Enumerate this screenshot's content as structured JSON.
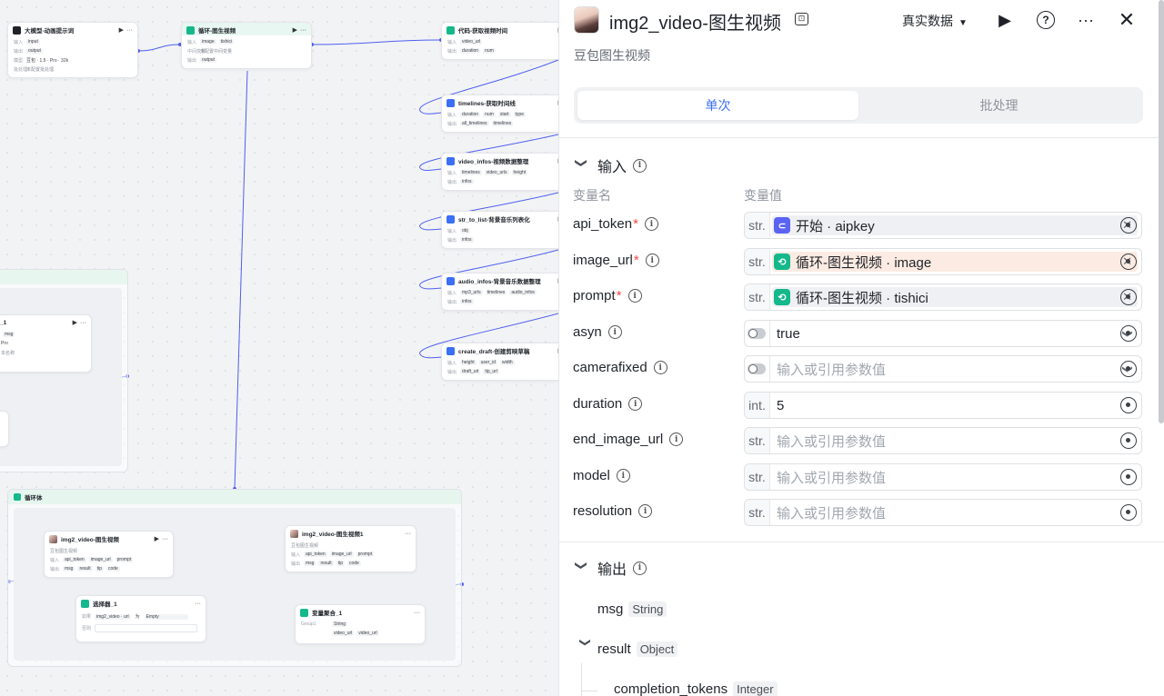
{
  "canvas": {
    "nodes": {
      "llm": {
        "title": "大模型-动画提示词",
        "r1k": "输入",
        "r1": "input",
        "r2k": "输出",
        "r2": "output",
        "r3k": "模型",
        "r3": "豆包 · 1.5 · Pro · 32k",
        "r4k": "批处理",
        "r4": "未配置批处理"
      },
      "loop": {
        "title": "循环-图生视频",
        "r1k": "输入",
        "r1a": "image",
        "r1b": "tishici",
        "r2k": "中间变量",
        "r2": "未配置中间变量",
        "r3k": "输出",
        "r3": "output"
      },
      "code": {
        "title": "代码-获取视频时间",
        "r1k": "输入",
        "r1": "video_url",
        "r2k": "输出",
        "r2a": "duration",
        "r2b": "num"
      },
      "timelines": {
        "title": "timelines-获取时间线",
        "r1k": "输入",
        "r1a": "duration",
        "r1b": "num",
        "r1c": "start",
        "r1d": "type",
        "r2k": "输出",
        "r2a": "all_timelines",
        "r2b": "timelines"
      },
      "video_infos": {
        "title": "video_infos-视频数据整理",
        "r1k": "输入",
        "r1a": "timelines",
        "r1b": "video_urls",
        "r1c": "height",
        "r2k": "输出",
        "r2": "infos"
      },
      "str_to_list": {
        "title": "str_to_list-背景音乐列表化",
        "r1k": "输入",
        "r1": "obj",
        "r2k": "输出",
        "r2": "infos"
      },
      "audio_infos": {
        "title": "audio_infos-背景音乐数据整理",
        "r1k": "输入",
        "r1a": "mp3_urls",
        "r1b": "timelines",
        "r1c": "audio_infos",
        "r2k": "输出",
        "r2": "infos"
      },
      "create_draft": {
        "title": "create_draft-创建剪映草稿",
        "r1k": "输入",
        "r1a": "height",
        "r1b": "user_id",
        "r1c": "width",
        "r2k": "输出",
        "r2a": "draft_url",
        "r2b": "tip_url"
      },
      "partial": {
        "title": "_1",
        "r1": "msg",
        "r2": "Pro",
        "r3": "本名称"
      },
      "loopbody": {
        "title": "循环体"
      },
      "img2video": {
        "title": "img2_video-图生视频",
        "sub": "豆包图生视频",
        "r1k": "输入",
        "r1a": "api_token",
        "r1b": "image_url",
        "r1c": "prompt",
        "r2k": "输出",
        "r2a": "msg",
        "r2b": "result",
        "r2c": "tip",
        "r2d": "code"
      },
      "img2video1": {
        "title": "img2_video-图生视频1",
        "sub": "豆包图生视频",
        "r1k": "输入",
        "r1a": "api_token",
        "r1b": "image_url",
        "r1c": "prompt",
        "r2k": "输出",
        "r2a": "msg",
        "r2b": "result",
        "r2c": "tip",
        "r2d": "code"
      },
      "selector": {
        "title": "选择器_1",
        "r1k": "如果",
        "r1a": "img2_video · url",
        "r1b": "为",
        "r1c": "Empty",
        "r2k": "否则"
      },
      "aggregate": {
        "title": "变量聚合_1",
        "r1k": "Group1",
        "r1": "String",
        "r2a": "video_url",
        "r2b": "video_url"
      }
    }
  },
  "panel": {
    "title": "img2_video-图生视频",
    "subtitle": "豆包图生视频",
    "data_mode": "真实数据",
    "tabs": [
      {
        "label": "单次",
        "active": true
      },
      {
        "label": "批处理",
        "active": false
      }
    ],
    "input_section": "输入",
    "col_name": "变量名",
    "col_value": "变量值",
    "params": [
      {
        "name": "api_token",
        "required": true,
        "type": "str.",
        "kind": "ref",
        "ref": "开始 · aipkey",
        "color": "#5b63f5",
        "warm": false
      },
      {
        "name": "image_url",
        "required": true,
        "type": "str.",
        "kind": "ref",
        "ref": "循环-图生视频 · image",
        "color": "#14b88a",
        "warm": true
      },
      {
        "name": "prompt",
        "required": true,
        "type": "str.",
        "kind": "ref",
        "ref": "循环-图生视频 · tishici",
        "color": "#14b88a",
        "warm": false
      },
      {
        "name": "asyn",
        "required": false,
        "type": "toggle",
        "kind": "select",
        "value": "true",
        "placeholder": false
      },
      {
        "name": "camerafixed",
        "required": false,
        "type": "toggle",
        "kind": "select",
        "value": "输入或引用参数值",
        "placeholder": true
      },
      {
        "name": "duration",
        "required": false,
        "type": "int.",
        "kind": "text",
        "value": "5",
        "placeholder": false
      },
      {
        "name": "end_image_url",
        "required": false,
        "type": "str.",
        "kind": "text",
        "value": "输入或引用参数值",
        "placeholder": true
      },
      {
        "name": "model",
        "required": false,
        "type": "str.",
        "kind": "text",
        "value": "输入或引用参数值",
        "placeholder": true
      },
      {
        "name": "resolution",
        "required": false,
        "type": "str.",
        "kind": "text",
        "value": "输入或引用参数值",
        "placeholder": true
      }
    ],
    "output_section": "输出",
    "outputs": [
      {
        "name": "msg",
        "type": "String"
      },
      {
        "name": "result",
        "type": "Object"
      },
      {
        "name": "completion_tokens",
        "type": "Integer"
      }
    ]
  }
}
